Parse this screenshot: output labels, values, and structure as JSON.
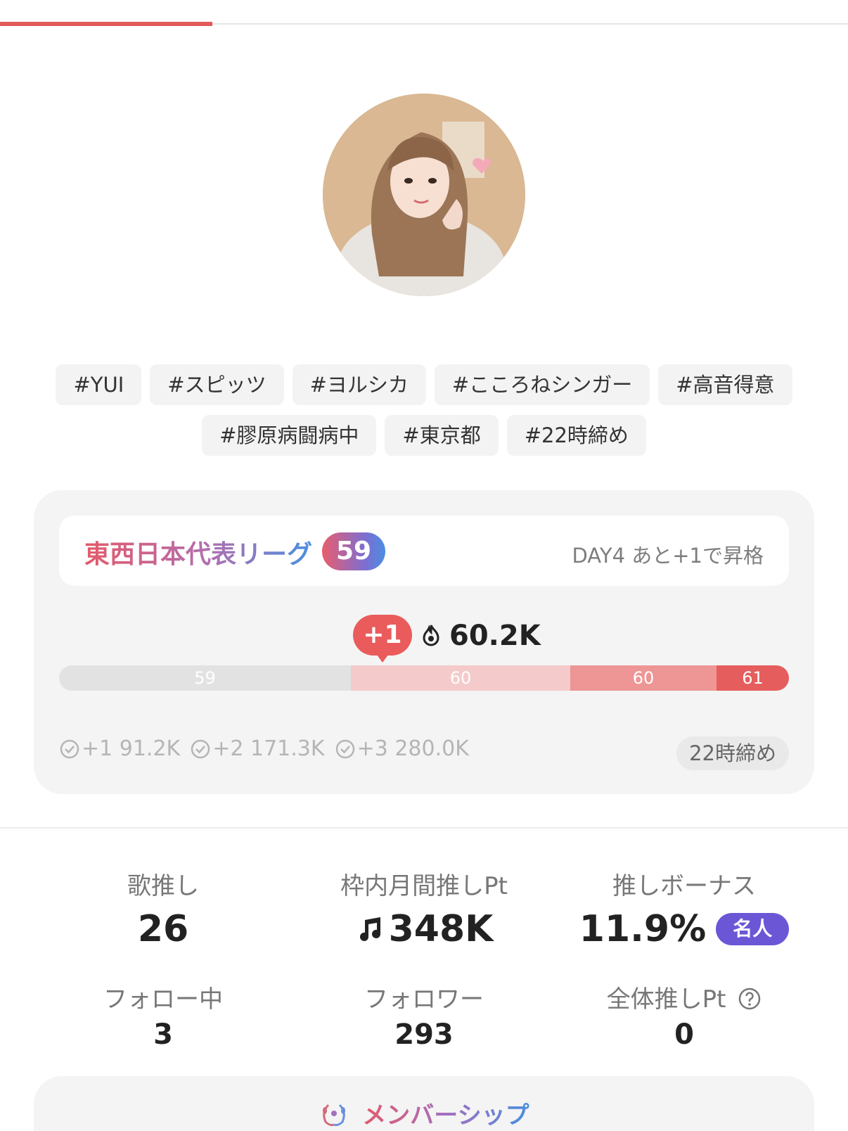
{
  "progress": {
    "fraction": 0.25
  },
  "profile": {
    "avatar_alt": "profile photo"
  },
  "tags": [
    "#YUI",
    "#スピッツ",
    "#ヨルシカ",
    "#こころねシンガー",
    "#高音得意",
    "#膠原病闘病中",
    "#東京都",
    "#22時締め"
  ],
  "league": {
    "name": "東西日本代表リーグ",
    "rank": "59",
    "status": "DAY4 あと+1で昇格",
    "bubble": "+1",
    "points": "60.2K",
    "segments": [
      "59",
      "60",
      "60",
      "61"
    ],
    "thresholds": [
      "+1 91.2K",
      "+2 171.3K",
      "+3 280.0K"
    ],
    "deadline": "22時締め"
  },
  "stats": {
    "song_oshi": {
      "label": "歌推し",
      "value": "26"
    },
    "monthly_pt": {
      "label": "枠内月間推しPt",
      "value": "348K"
    },
    "bonus": {
      "label": "推しボーナス",
      "value": "11.9%",
      "badge": "名人"
    },
    "following": {
      "label": "フォロー中",
      "value": "3"
    },
    "followers": {
      "label": "フォロワー",
      "value": "293"
    },
    "total_pt": {
      "label": "全体推しPt",
      "value": "0"
    }
  },
  "membership": {
    "title": "メンバーシップ"
  },
  "colors": {
    "accent": "#e35a5a",
    "badge": "#6b57d6",
    "card_bg": "#f4f4f4"
  }
}
